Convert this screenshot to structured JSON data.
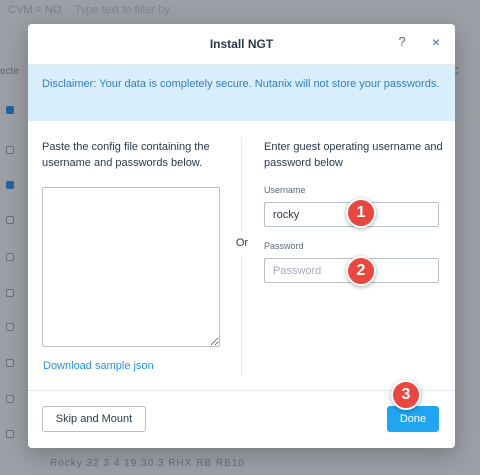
{
  "background": {
    "filter_label": "CVM = NO",
    "filter_placeholder": "Type text to filter by",
    "column_label_left": "ecte",
    "column_label_right": "C",
    "bottom_row": "Rocky 32   3   4   19.30.3   RHX RB RB10"
  },
  "modal": {
    "title": "Install NGT",
    "help_icon": "?",
    "close_icon": "×",
    "disclaimer": "Disclaimer: Your data is completely secure. Nutanix will not store your passwords.",
    "left": {
      "instructions": "Paste the config file containing the username and passwords below.",
      "textarea_value": "",
      "download_link": "Download sample json"
    },
    "or_label": "Or",
    "right": {
      "instructions": "Enter guest operating username and password below",
      "username_label": "Username",
      "username_value": "rocky",
      "password_label": "Password",
      "password_placeholder": "Password"
    },
    "footer": {
      "skip_label": "Skip and Mount",
      "done_label": "Done"
    }
  },
  "annotations": {
    "step1": "1",
    "step2": "2",
    "step3": "3",
    "badge_color": "#e8483f"
  }
}
